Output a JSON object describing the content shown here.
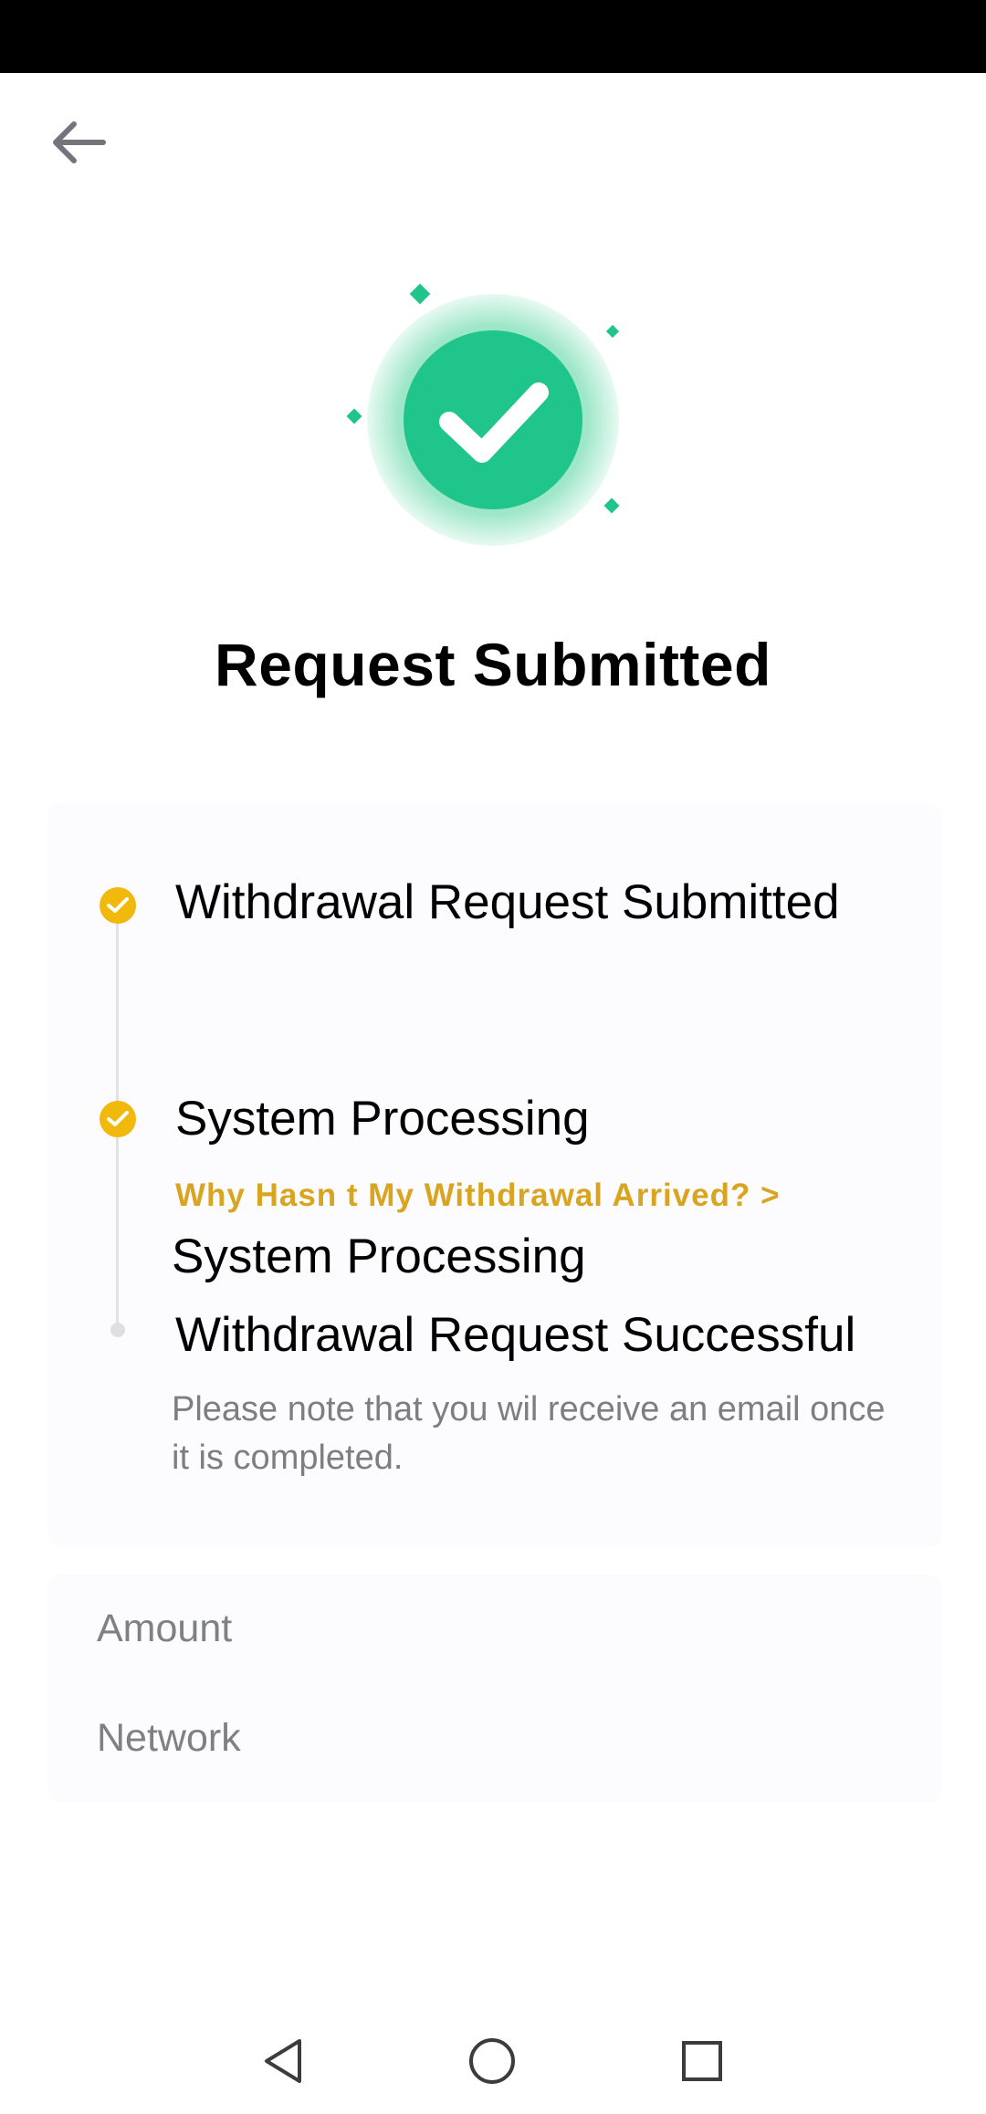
{
  "header": {
    "back_icon": "arrow-left-icon"
  },
  "hero": {
    "icon": "success-check-icon",
    "accent_color": "#20c58c",
    "light_color": "#c9f2e1"
  },
  "title": "Request Submitted",
  "timeline": {
    "status_color": "#f0b90b",
    "steps": [
      {
        "label": "Withdrawal Request Submitted",
        "status": "done"
      },
      {
        "label": "System Processing",
        "status": "done"
      },
      {
        "label": "System Processing",
        "status": "current"
      },
      {
        "label": "Withdrawal Request Successful",
        "status": "pending"
      }
    ],
    "help_link": "Why Hasn t My Withdrawal Arrived? >",
    "note": "Please note that you wil receive an email once it is completed."
  },
  "details": {
    "amount_label": "Amount",
    "network_label": "Network"
  },
  "nav": {
    "back_icon": "triangle-back-icon",
    "home_icon": "circle-home-icon",
    "recents_icon": "square-recents-icon"
  }
}
